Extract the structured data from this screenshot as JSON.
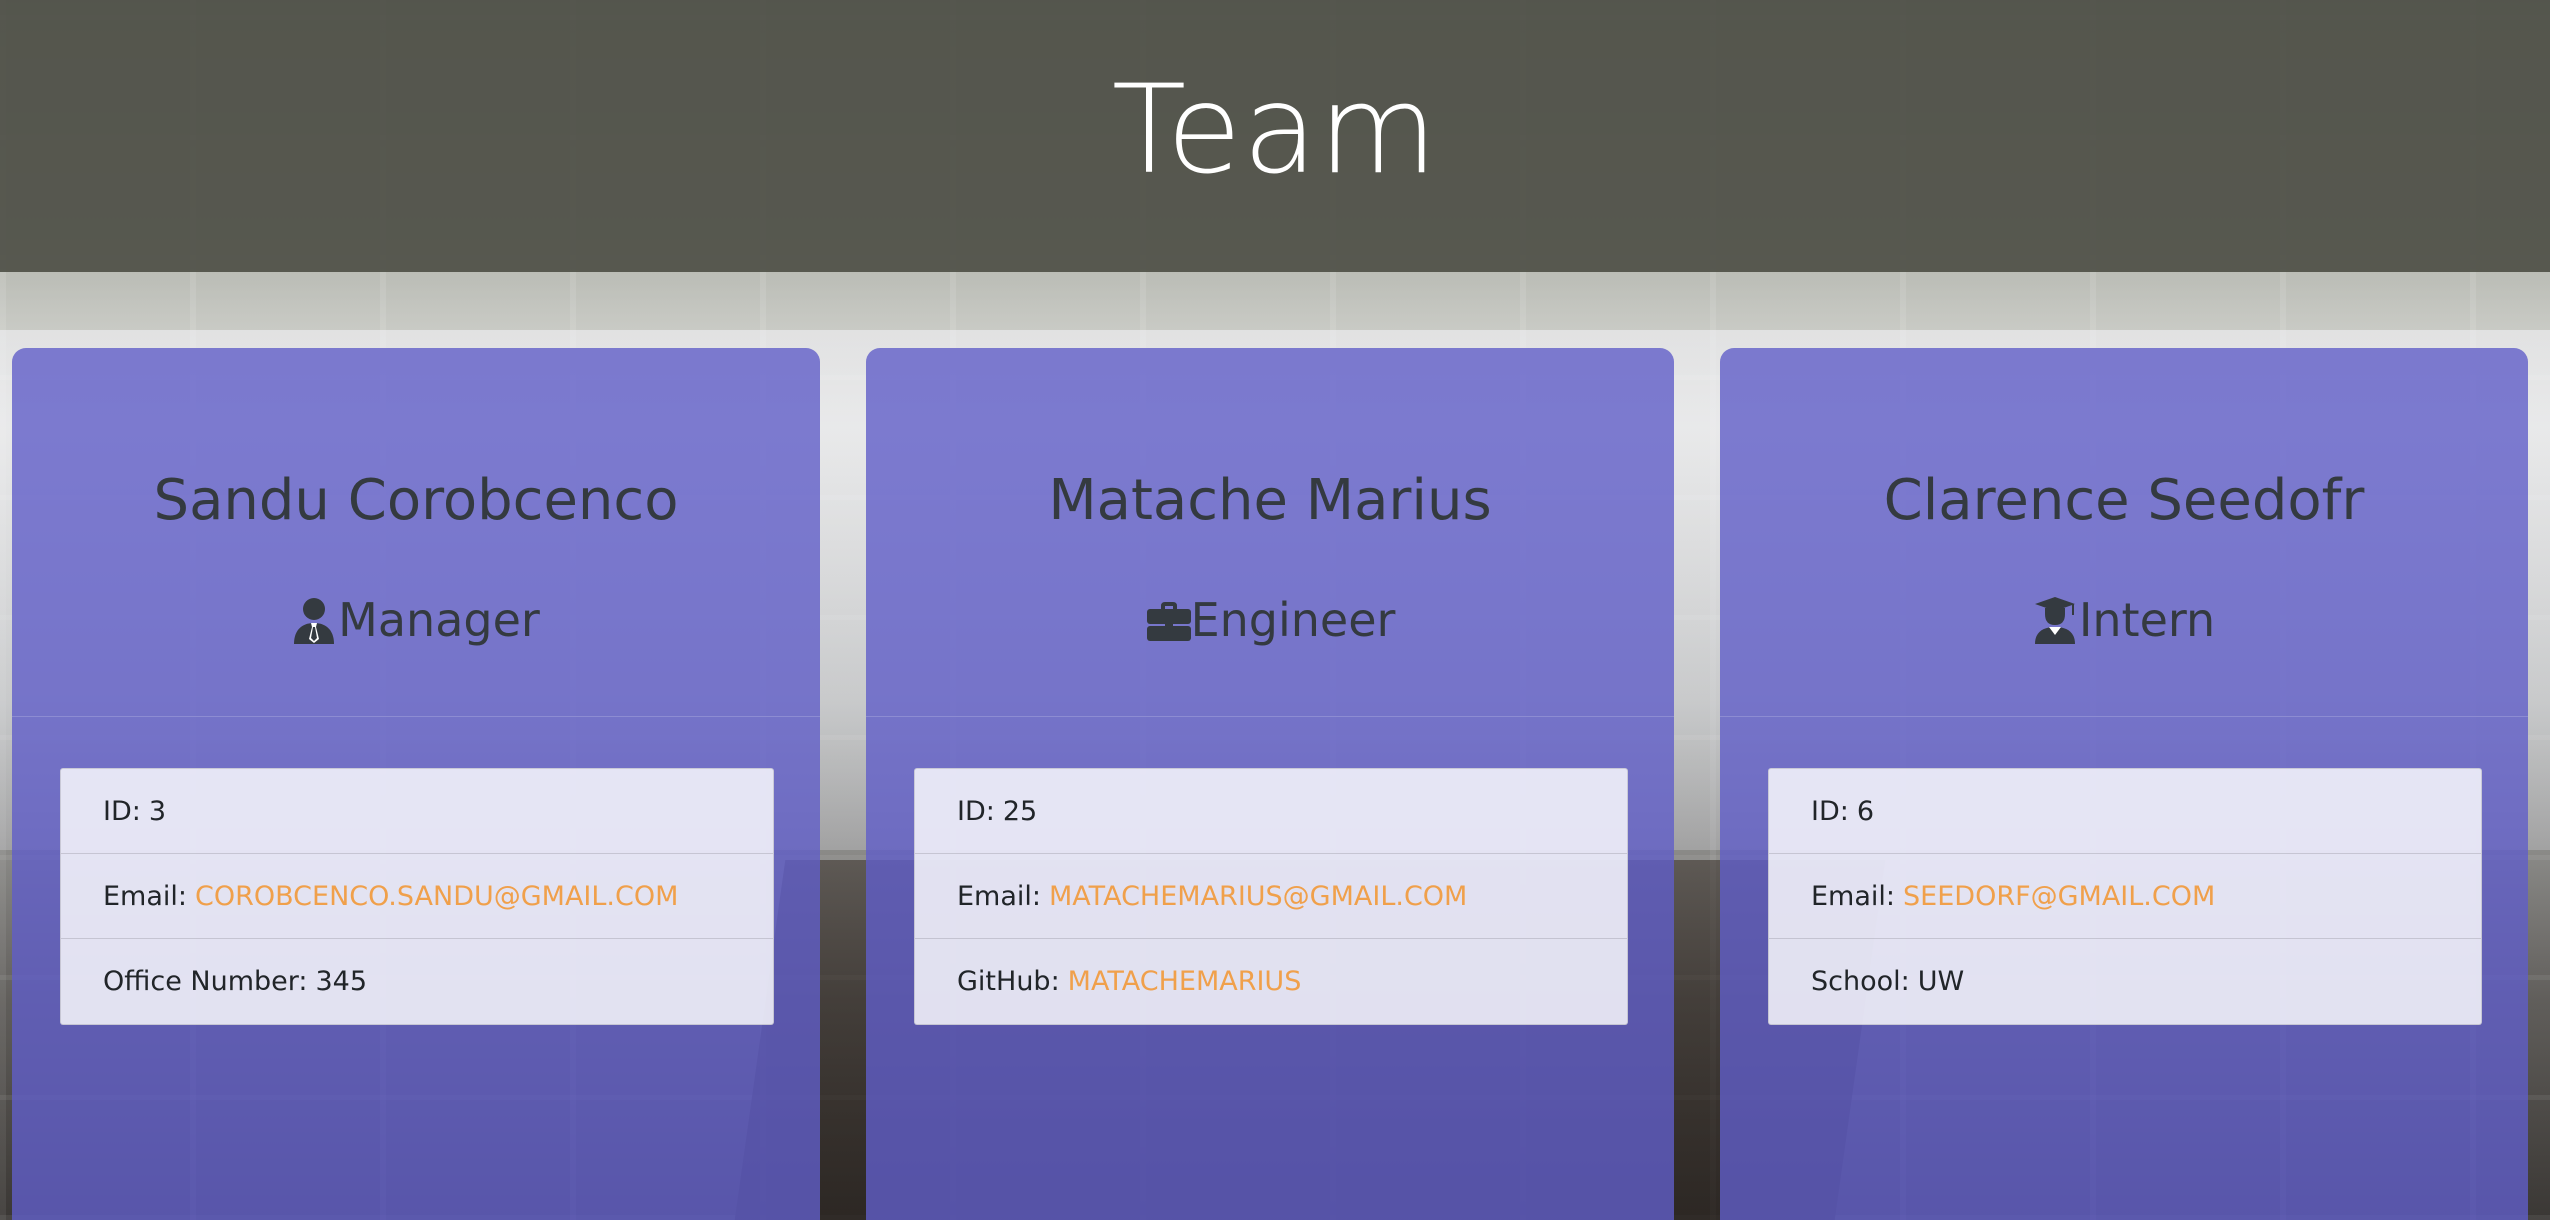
{
  "page": {
    "title": "Team",
    "colors": {
      "header_bg": "#4e4f47",
      "card_bg": "#605ec8",
      "link": "#f0a04b",
      "text": "#343a40"
    }
  },
  "cards": [
    {
      "name": "Sandu Corobcenco",
      "role": "Manager",
      "role_icon": "user-tie-icon",
      "id_label": "ID:",
      "id_value": "3",
      "email_label": "Email:",
      "email": "COROBCENCO.SANDU@GMAIL.COM",
      "extra_label": "Office Number:",
      "extra_value": "345"
    },
    {
      "name": "Matache Marius",
      "role": "Engineer",
      "role_icon": "briefcase-icon",
      "id_label": "ID:",
      "id_value": "25",
      "email_label": "Email:",
      "email": "MATACHEMARIUS@GMAIL.COM",
      "extra_label": "GitHub:",
      "extra_value": "MATACHEMARIUS"
    },
    {
      "name": "Clarence Seedofr",
      "role": "Intern",
      "role_icon": "user-graduate-icon",
      "id_label": "ID:",
      "id_value": "6",
      "email_label": "Email:",
      "email": "SEEDORF@GMAIL.COM",
      "extra_label": "School:",
      "extra_value": "UW"
    }
  ]
}
